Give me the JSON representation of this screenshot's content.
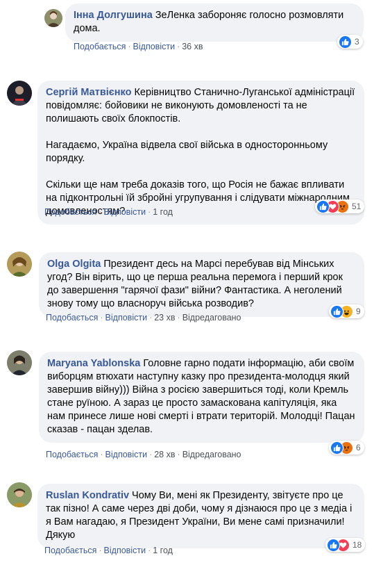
{
  "comments": [
    {
      "author": "Інна Долгушина",
      "paragraphs": [
        "ЗеЛенка забороняє голосно розмовляти дома."
      ],
      "like_label": "Подобається",
      "reply_label": "Відповісти",
      "time": "36 хв",
      "edited": "",
      "reactions": [
        "like"
      ],
      "reaction_count": "3"
    },
    {
      "author": "Сергій Матвієнко",
      "paragraphs": [
        "Керівництво Станично-Луганської адміністрації повідомляє: бойовики не виконують домовленості та не полишають своїх блокпостів.",
        "Нагадаємо, Україна відвела свої війська в односторонньому порядку.",
        "Скільки ще нам треба доказів того, що Росія не бажає впливати на підконтрольні їй збройні угрупування і слідувати міжнародним домовленостям?"
      ],
      "like_label": "Подобається",
      "reply_label": "Відповісти",
      "time": "1 год",
      "edited": "",
      "reactions": [
        "like",
        "love",
        "angry"
      ],
      "reaction_count": "51"
    },
    {
      "author": "Olga Olgita",
      "paragraphs": [
        "Президент десь на Марсі перебував від Мінських угод? Він вірить, що це перша реальна перемога і перший крок до завершення \"гарячої фази\" війни? Фантастика. А неголений знову тому що власноруч війська розводив?"
      ],
      "like_label": "Подобається",
      "reply_label": "Відповісти",
      "time": "23 хв",
      "edited": "Відредаговано",
      "reactions": [
        "like",
        "haha"
      ],
      "reaction_count": "9"
    },
    {
      "author": "Maryana Yablonska",
      "paragraphs": [
        "Головне гарно подати інформацію, аби своїм виборцям втюхати наступну казку про президента-молодця який завершив війну))) Війна з росією завершиться тоді, коли Кремль стане руїною. А зараз це просто замаскована капітуляція, яка нам принесе лише нові смерті і втрати територій. Молодці! Пацан сказав - пацан зделав."
      ],
      "like_label": "Подобається",
      "reply_label": "Відповісти",
      "time": "28 хв",
      "edited": "Відредаговано",
      "reactions": [
        "like",
        "angry"
      ],
      "reaction_count": "6"
    },
    {
      "author": "Ruslan Kondrativ",
      "paragraphs": [
        "Чому Ви, мені як Президенту, звітуєте про це так пізно! А саме через дві доби, чому я дізнаюся про це з медіа і я Вам нагадаю, я Президент України, Ви мене самі призначили! Дякую"
      ],
      "like_label": "Подобається",
      "reply_label": "Відповісти",
      "time": "1 год",
      "edited": "",
      "reactions": [
        "like",
        "love"
      ],
      "reaction_count": "18"
    }
  ],
  "separator": "·",
  "colors": {
    "bubble": "#f0f2f5",
    "author": "#385898",
    "like": "#1877f2",
    "love": "#f33e58",
    "angry": "#e9710f",
    "haha": "#f7b125"
  }
}
